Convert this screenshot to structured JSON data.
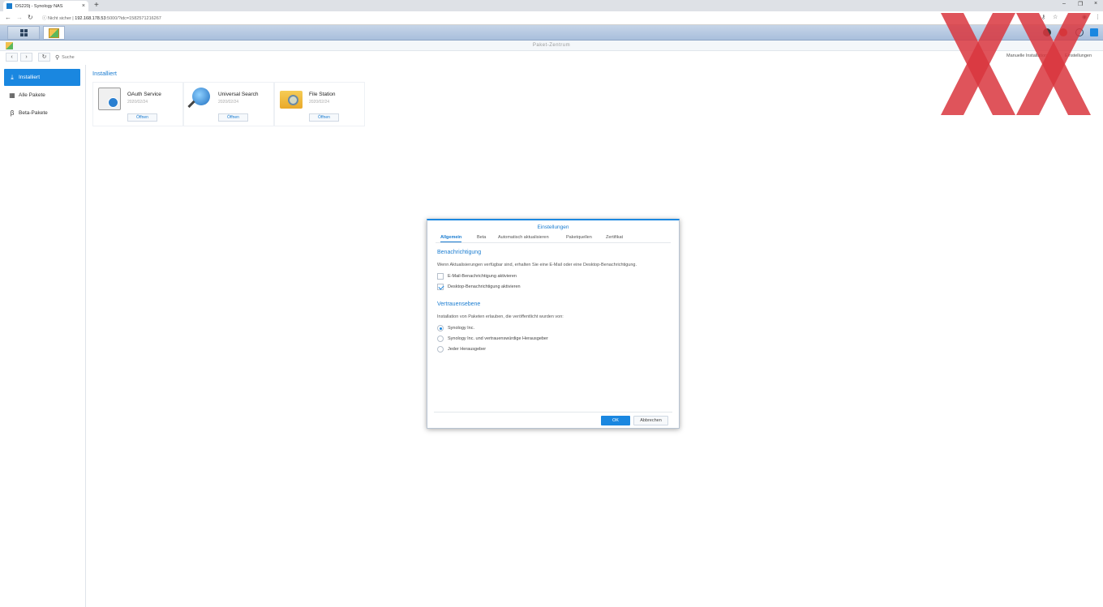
{
  "browser": {
    "tab_title": "DS220j - Synology NAS",
    "tab_close": "×",
    "new_tab": "+",
    "window_controls": [
      "–",
      "❐",
      "×"
    ],
    "url_security": "Nicht sicher",
    "url_separator": "|",
    "url_host": "192.168.178.53",
    "url_rest": ":5000/?idc=1582571216267"
  },
  "window": {
    "title": "Paket-Zentrum"
  },
  "toolbar": {
    "search_placeholder": "Suche",
    "manual_install": "Manuelle Installation",
    "settings": "Einstellungen"
  },
  "sidebar": {
    "items": [
      {
        "label": "Installiert",
        "icon": "download-icon"
      },
      {
        "label": "Alle Pakete",
        "icon": "grid-icon"
      },
      {
        "label": "Beta-Pakete",
        "icon": "beta-icon"
      }
    ]
  },
  "main": {
    "section_title": "Installiert",
    "packages": [
      {
        "name": "OAuth Service",
        "date": "2020/02/24",
        "button": "Öffnen",
        "icon": "oauth-icon"
      },
      {
        "name": "Universal Search",
        "date": "2020/02/24",
        "button": "Öffnen",
        "icon": "magnifier-icon"
      },
      {
        "name": "File Station",
        "date": "2020/02/24",
        "button": "Öffnen",
        "icon": "folder-icon"
      }
    ]
  },
  "dialog": {
    "title": "Einstellungen",
    "tabs": [
      "Allgemein",
      "Beta",
      "Automatisch aktualisieren",
      "Paketquellen",
      "Zertifikat"
    ],
    "active_tab": "Allgemein",
    "notification": {
      "title": "Benachrichtigung",
      "description": "Wenn Aktualisierungen verfügbar sind, erhalten Sie eine E-Mail oder eine Desktop-Benachrichtigung.",
      "email_label": "E-Mail-Benachrichtigung aktivieren",
      "email_checked": false,
      "desktop_label": "Desktop-Benachrichtigung aktivieren",
      "desktop_checked": true
    },
    "trust": {
      "title": "Vertrauensebene",
      "description": "Installation von Paketen erlauben, die veröffentlicht wurden von:",
      "options": [
        "Synology Inc.",
        "Synology Inc. und vertrauenswürdige Herausgeber",
        "Jeder Herausgeber"
      ],
      "selected": "Synology Inc."
    },
    "ok": "OK",
    "cancel": "Abbrechen"
  },
  "colors": {
    "accent": "#1a87e0",
    "watermark": "#d9363e"
  }
}
